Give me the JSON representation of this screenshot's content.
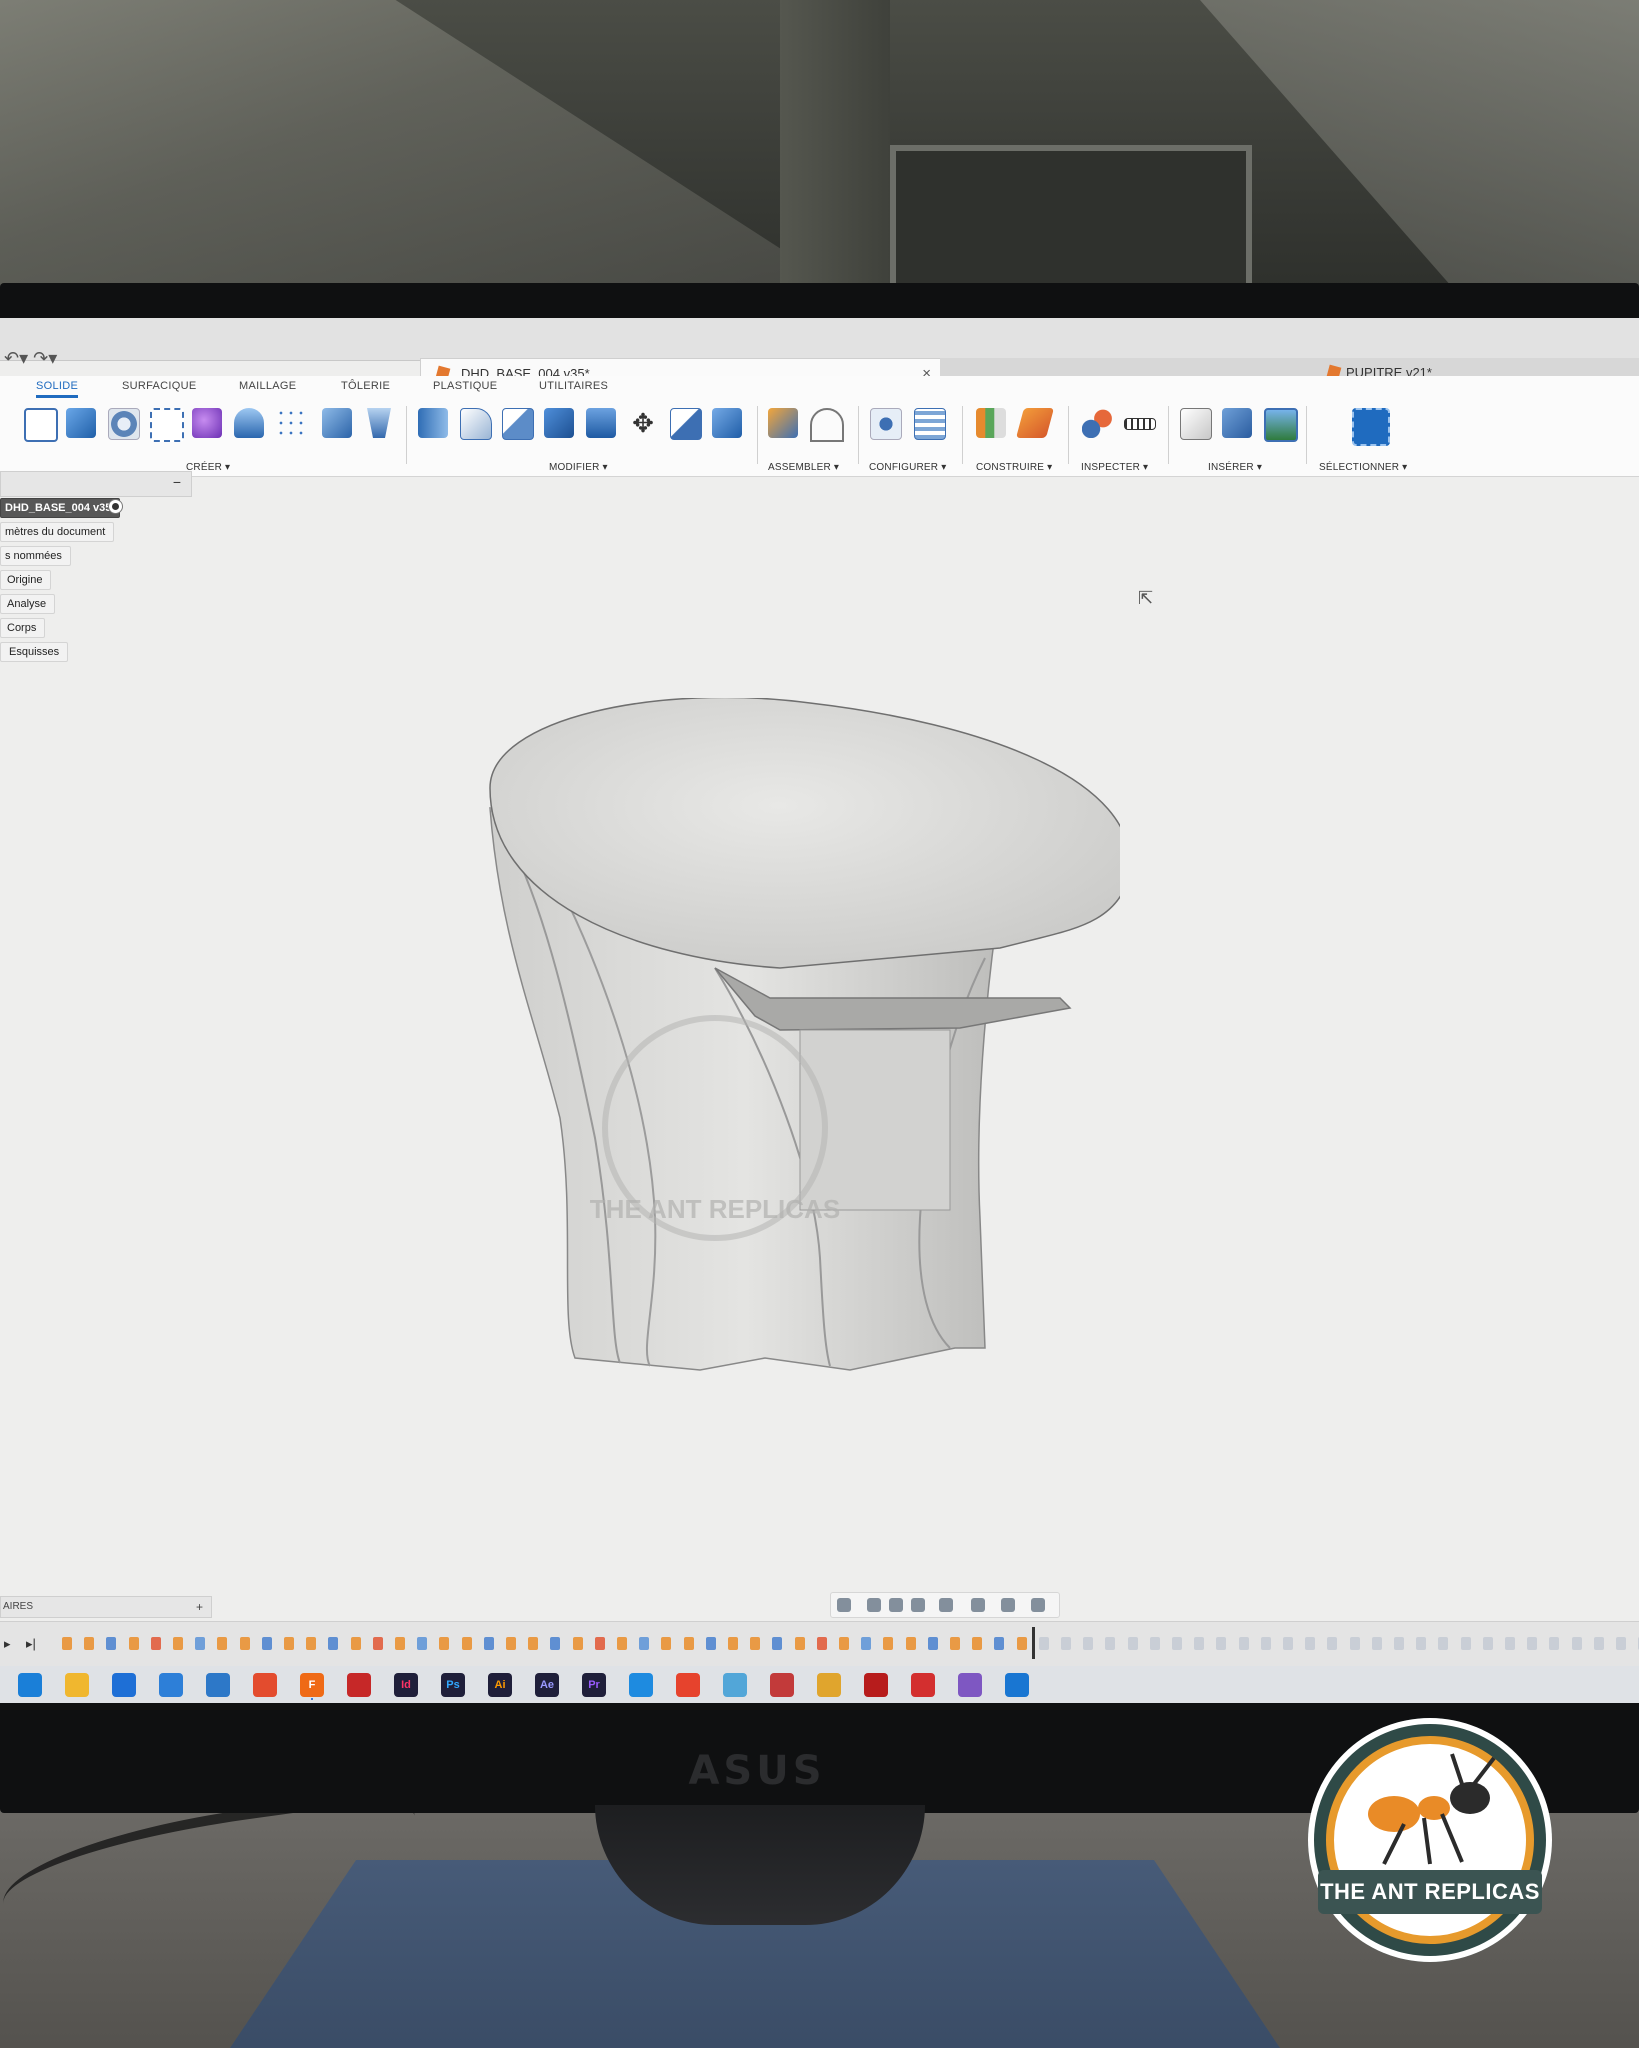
{
  "tabs": {
    "active": {
      "label": "DHD_BASE_004 v35*",
      "close": "×"
    },
    "inactive": {
      "label": "PUPITRE v21*"
    }
  },
  "undo": "↶▾ ↷▾",
  "workspaces": [
    "SOLIDE",
    "SURFACIQUE",
    "MAILLAGE",
    "TÔLERIE",
    "PLASTIQUE",
    "UTILITAIRES"
  ],
  "tool_groups": [
    "CRÉER ▾",
    "MODIFIER ▾",
    "ASSEMBLER ▾",
    "CONFIGURER ▾",
    "CONSTRUIRE ▾",
    "INSPECTER ▾",
    "INSÉRER ▾",
    "SÉLECTIONNER ▾"
  ],
  "browser": {
    "minus": "−",
    "root": "DHD_BASE_004 v35",
    "items": [
      "mètres du document",
      "s nommées",
      "Origine",
      "Analyse",
      "Corps",
      "Esquisses"
    ]
  },
  "comments": {
    "label": "AIRES",
    "plus": "+"
  },
  "timeline": {
    "prev": "▸",
    "play": "▸|"
  },
  "taskbar_apps": [
    "",
    "",
    "",
    "",
    "",
    "",
    "F",
    "",
    "Id",
    "Ps",
    "Ai",
    "Ae",
    "Pr",
    "",
    "",
    "",
    "",
    "",
    "",
    "",
    "",
    ""
  ],
  "monitor_brand": "ASUS",
  "watermark": "THE ANT REPLICAS",
  "logo_text": "THE ANT REPLICAS",
  "cursor": "⇱"
}
